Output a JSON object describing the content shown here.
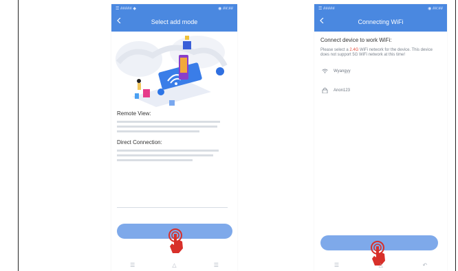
{
  "left_phone": {
    "status_left": "☰ ##### ◆",
    "status_right": "◉ ##:##",
    "title": "Select add mode",
    "remote_view_title": "Remote View:",
    "remote_view_desc": "",
    "direct_connection_title": "Direct Connection:",
    "direct_connection_desc": "",
    "primary_button_label": "",
    "below_button_text": ""
  },
  "right_phone": {
    "status_left": "☰ #####",
    "status_right": "◉ ##:##",
    "title": "Connecting WiFi",
    "connect_title": "Connect device to work WiFi:",
    "desc_before": "Please select a ",
    "desc_highlight": "2.4G",
    "desc_after": " WiFi network for the device. This device does not support 5G WiFi network at this time!",
    "wifi_name": "Wyangyy",
    "password": "Anon123",
    "primary_button_label": ""
  },
  "colors": {
    "accent": "#4a88e0",
    "button": "#7ea9ea",
    "highlight": "#e24b3a",
    "hand": "#d8302a"
  },
  "icons": [
    "back-icon",
    "wifi-icon",
    "lock-icon",
    "menu-icon",
    "home-icon",
    "return-icon",
    "hand-cursor-icon"
  ]
}
